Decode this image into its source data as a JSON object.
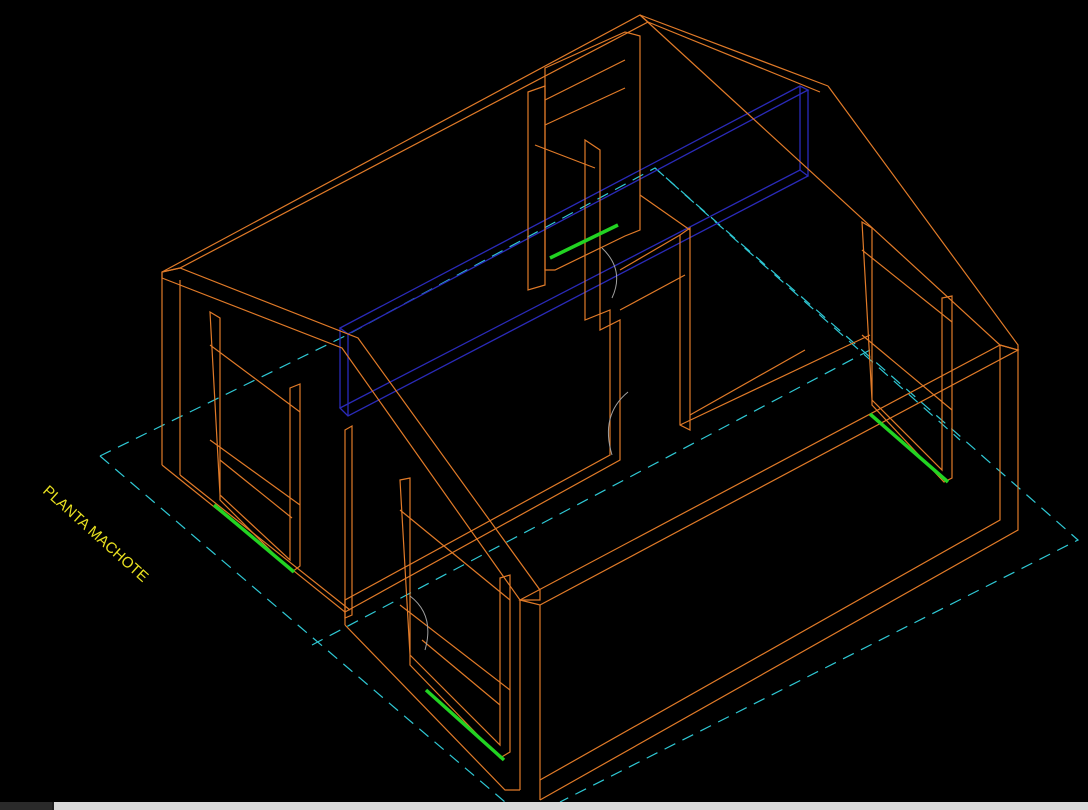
{
  "drawing": {
    "label": "PLANTA MACHOTE",
    "colors": {
      "background": "#000000",
      "walls": "#e07a28",
      "beams": "#2a2ab8",
      "floor_outline": "#2fc8d4",
      "windows": "#22d322",
      "door_arcs": "#a0a0a0",
      "label": "#e8e020"
    }
  },
  "statusbar": {
    "colors": {
      "base": "#1e1e1e",
      "left": "#2a2a2a",
      "right": "#d9d9d9"
    }
  }
}
